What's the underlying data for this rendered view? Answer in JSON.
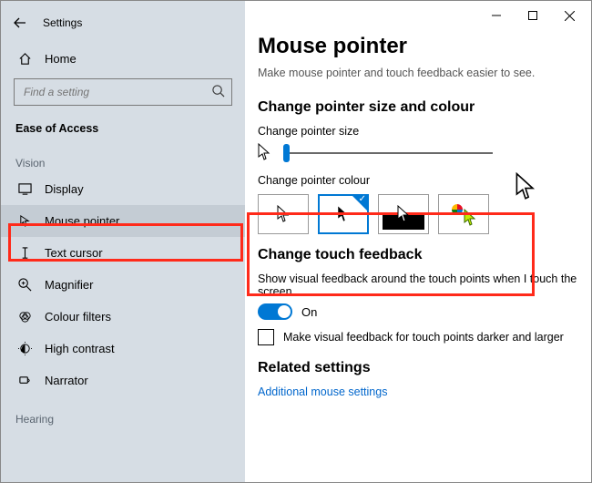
{
  "window": {
    "title": "Settings"
  },
  "sidebar": {
    "home": "Home",
    "search_placeholder": "Find a setting",
    "section": "Ease of Access",
    "category_vision": "Vision",
    "category_hearing": "Hearing",
    "items": [
      {
        "label": "Display"
      },
      {
        "label": "Mouse pointer"
      },
      {
        "label": "Text cursor"
      },
      {
        "label": "Magnifier"
      },
      {
        "label": "Colour filters"
      },
      {
        "label": "High contrast"
      },
      {
        "label": "Narrator"
      }
    ]
  },
  "main": {
    "title": "Mouse pointer",
    "subtitle": "Make mouse pointer and touch feedback easier to see.",
    "size_colour_heading": "Change pointer size and colour",
    "size_label": "Change pointer size",
    "colour_label": "Change pointer colour",
    "touch_heading": "Change touch feedback",
    "touch_desc": "Show visual feedback around the touch points when I touch the screen",
    "toggle_state": "On",
    "check_label": "Make visual feedback for touch points darker and larger",
    "related_heading": "Related settings",
    "related_link": "Additional mouse settings"
  }
}
